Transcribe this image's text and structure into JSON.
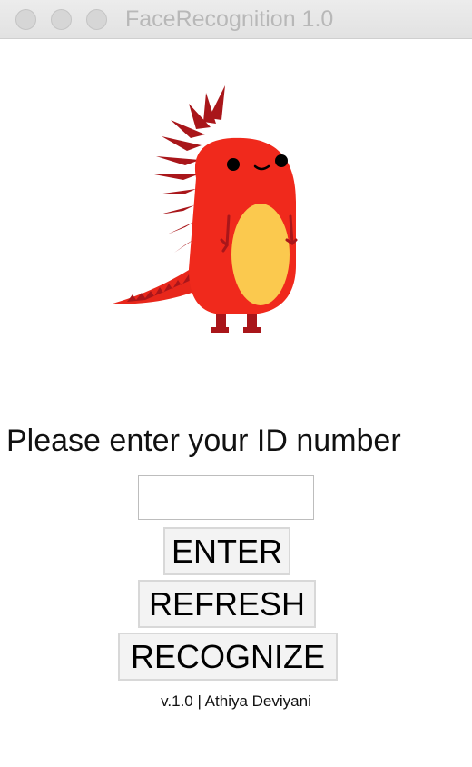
{
  "window": {
    "title": "FaceRecognition 1.0"
  },
  "mascot": {
    "icon": "red-dragon-mascot",
    "body_color": "#f0291c",
    "belly_color": "#fbc94e",
    "spike_color": "#a9161a"
  },
  "form": {
    "prompt": "Please enter your ID number",
    "id_input_value": "",
    "enter_label": "ENTER",
    "refresh_label": "REFRESH",
    "recognize_label": "RECOGNIZE"
  },
  "footer": {
    "text": "v.1.0 | Athiya Deviyani"
  }
}
